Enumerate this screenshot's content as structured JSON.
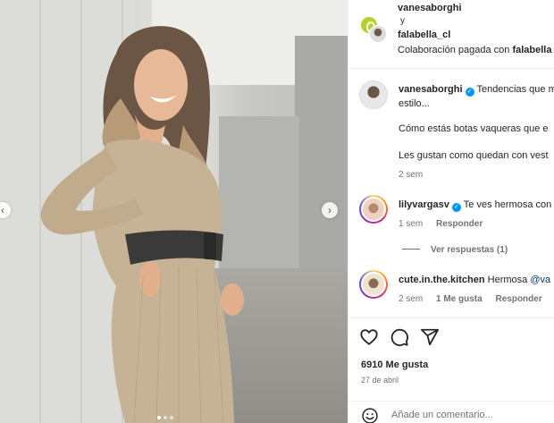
{
  "post": {
    "author": "vanesaborghi",
    "connector": "y",
    "collaborator": "falabella_cl",
    "paid_prefix": "Colaboración pagada con ",
    "paid_brand": "falabella"
  },
  "caption": {
    "user": "vanesaborghi",
    "line1": "Tendencias que m",
    "line2": "estilo...",
    "line3": "Cómo estás botas vaqueras que e",
    "line4": "Les gustan como quedan con vest",
    "time": "2 sem"
  },
  "comments": [
    {
      "user": "lilyvargasv",
      "text": "Te ves hermosa con",
      "time": "1 sem",
      "reply": "Responder",
      "view_replies": "Ver respuestas (1)"
    },
    {
      "user": "cute.in.the.kitchen",
      "text": "Hermosa ",
      "mention": "@va",
      "time": "2 sem",
      "likes": "1 Me gusta",
      "reply": "Responder"
    }
  ],
  "footer": {
    "likes": "6910 Me gusta",
    "date": "27 de abril",
    "add_comment_placeholder": "Añade un comentario..."
  },
  "carousel": {
    "prev": "‹",
    "next": "›"
  },
  "colors": {
    "verified": "#0095f6",
    "falabella_green": "#b8cf2e",
    "meta_text": "#737373"
  }
}
